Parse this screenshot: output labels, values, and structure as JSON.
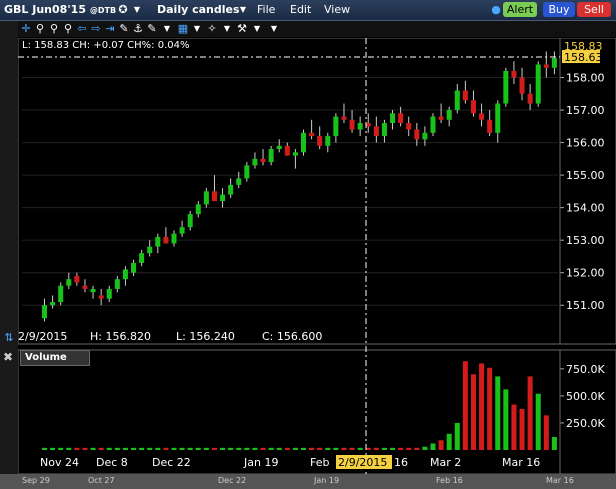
{
  "titlebar": {
    "symbol": "GBL Jun08'15",
    "exchange": "@DTB",
    "timeframe": "Daily candles",
    "menu": [
      "File",
      "Edit",
      "View"
    ],
    "alert": "Alert",
    "buy": "Buy",
    "sell": "Sell"
  },
  "info": {
    "line": "L: 158.83 CH: +0.07 CH%: 0.04%",
    "price_tag": "158.63",
    "price_tag_top": "158.83"
  },
  "ohlc": {
    "date": "2/9/2015",
    "high": "H: 156.820",
    "low": "L: 156.240",
    "close": "C: 156.600"
  },
  "volume_panel": {
    "label": "Volume"
  },
  "crosshair_date": "2/9/2015",
  "chart_data": {
    "type": "candlestick",
    "price_axis_ticks": [
      "158.00",
      "157.00",
      "156.00",
      "155.00",
      "154.00",
      "153.00",
      "152.00",
      "151.00"
    ],
    "price_axis_values": [
      158,
      157,
      156,
      155,
      154,
      153,
      152,
      151
    ],
    "volume_axis_ticks": [
      "750.0K",
      "500.0K",
      "250.0K"
    ],
    "volume_axis_values": [
      750000,
      500000,
      250000
    ],
    "x_labels": [
      "Nov 24",
      "Dec 8",
      "Dec 22",
      "Jan 19",
      "Feb",
      "16",
      "Mar 2",
      "Mar 16"
    ],
    "overview_labels": [
      "Sep 29",
      "Oct 27",
      "Dec 22",
      "Jan 19",
      "Feb 16",
      "Mar 16"
    ],
    "candles": [
      [
        150.6,
        151.2,
        150.5,
        151.0
      ],
      [
        151.0,
        151.3,
        150.9,
        151.1
      ],
      [
        151.1,
        151.7,
        151.0,
        151.6
      ],
      [
        151.6,
        152.0,
        151.5,
        151.8
      ],
      [
        151.9,
        152.0,
        151.6,
        151.7
      ],
      [
        151.6,
        151.8,
        151.4,
        151.5
      ],
      [
        151.4,
        151.6,
        151.2,
        151.5
      ],
      [
        151.3,
        151.5,
        151.0,
        151.2
      ],
      [
        151.2,
        151.6,
        151.1,
        151.5
      ],
      [
        151.5,
        151.9,
        151.4,
        151.8
      ],
      [
        151.8,
        152.2,
        151.6,
        152.1
      ],
      [
        152.0,
        152.4,
        151.9,
        152.3
      ],
      [
        152.3,
        152.7,
        152.2,
        152.6
      ],
      [
        152.6,
        153.0,
        152.5,
        152.8
      ],
      [
        152.8,
        153.2,
        152.6,
        153.1
      ],
      [
        153.1,
        153.4,
        152.9,
        152.9
      ],
      [
        152.9,
        153.3,
        152.8,
        153.2
      ],
      [
        153.2,
        153.6,
        153.1,
        153.4
      ],
      [
        153.4,
        153.9,
        153.3,
        153.8
      ],
      [
        153.8,
        154.2,
        153.7,
        154.1
      ],
      [
        154.1,
        154.6,
        154.0,
        154.5
      ],
      [
        154.5,
        155.0,
        154.3,
        154.2
      ],
      [
        154.2,
        154.6,
        154.0,
        154.4
      ],
      [
        154.4,
        154.9,
        154.3,
        154.7
      ],
      [
        154.7,
        155.1,
        154.6,
        154.9
      ],
      [
        154.9,
        155.4,
        154.8,
        155.3
      ],
      [
        155.3,
        155.7,
        155.2,
        155.5
      ],
      [
        155.5,
        155.8,
        155.3,
        155.4
      ],
      [
        155.4,
        155.9,
        155.3,
        155.8
      ],
      [
        155.8,
        156.1,
        155.7,
        155.9
      ],
      [
        155.9,
        156.0,
        155.6,
        155.6
      ],
      [
        155.6,
        155.8,
        155.2,
        155.7
      ],
      [
        155.7,
        156.4,
        155.6,
        156.3
      ],
      [
        156.3,
        156.7,
        156.1,
        156.2
      ],
      [
        156.2,
        156.5,
        155.8,
        155.9
      ],
      [
        155.9,
        156.3,
        155.7,
        156.2
      ],
      [
        156.2,
        156.9,
        156.0,
        156.8
      ],
      [
        156.8,
        157.2,
        156.6,
        156.7
      ],
      [
        156.7,
        157.0,
        156.3,
        156.4
      ],
      [
        156.4,
        156.8,
        156.2,
        156.6
      ],
      [
        156.6,
        156.9,
        156.3,
        156.5
      ],
      [
        156.5,
        156.8,
        156.0,
        156.2
      ],
      [
        156.2,
        156.7,
        156.0,
        156.6
      ],
      [
        156.6,
        157.0,
        156.4,
        156.9
      ],
      [
        156.9,
        157.1,
        156.5,
        156.6
      ],
      [
        156.6,
        156.8,
        156.2,
        156.4
      ],
      [
        156.4,
        156.6,
        155.9,
        156.1
      ],
      [
        156.1,
        156.5,
        155.9,
        156.3
      ],
      [
        156.3,
        156.9,
        156.2,
        156.8
      ],
      [
        156.8,
        157.2,
        156.6,
        156.7
      ],
      [
        156.7,
        157.1,
        156.5,
        157.0
      ],
      [
        157.0,
        157.8,
        156.9,
        157.6
      ],
      [
        157.6,
        157.9,
        157.2,
        157.3
      ],
      [
        157.3,
        157.6,
        156.8,
        156.9
      ],
      [
        156.9,
        157.2,
        156.5,
        156.7
      ],
      [
        156.7,
        157.0,
        156.2,
        156.3
      ],
      [
        156.3,
        157.3,
        156.0,
        157.2
      ],
      [
        157.2,
        158.3,
        157.1,
        158.2
      ],
      [
        158.2,
        158.5,
        157.8,
        158.0
      ],
      [
        158.0,
        158.3,
        157.3,
        157.5
      ],
      [
        157.5,
        157.8,
        157.0,
        157.2
      ],
      [
        157.2,
        158.5,
        157.1,
        158.4
      ],
      [
        158.4,
        158.8,
        158.0,
        158.3
      ],
      [
        158.3,
        158.8,
        158.1,
        158.6
      ]
    ],
    "volumes": [
      20000,
      20000,
      20000,
      20000,
      20000,
      20000,
      20000,
      20000,
      20000,
      20000,
      20000,
      20000,
      20000,
      20000,
      20000,
      20000,
      20000,
      20000,
      20000,
      20000,
      20000,
      20000,
      20000,
      20000,
      20000,
      20000,
      20000,
      20000,
      20000,
      20000,
      20000,
      20000,
      20000,
      20000,
      20000,
      20000,
      20000,
      20000,
      20000,
      20000,
      20000,
      20000,
      20000,
      20000,
      20000,
      20000,
      20000,
      30000,
      60000,
      90000,
      150000,
      250000,
      820000,
      700000,
      800000,
      760000,
      680000,
      560000,
      420000,
      380000,
      680000,
      520000,
      320000,
      120000
    ]
  }
}
